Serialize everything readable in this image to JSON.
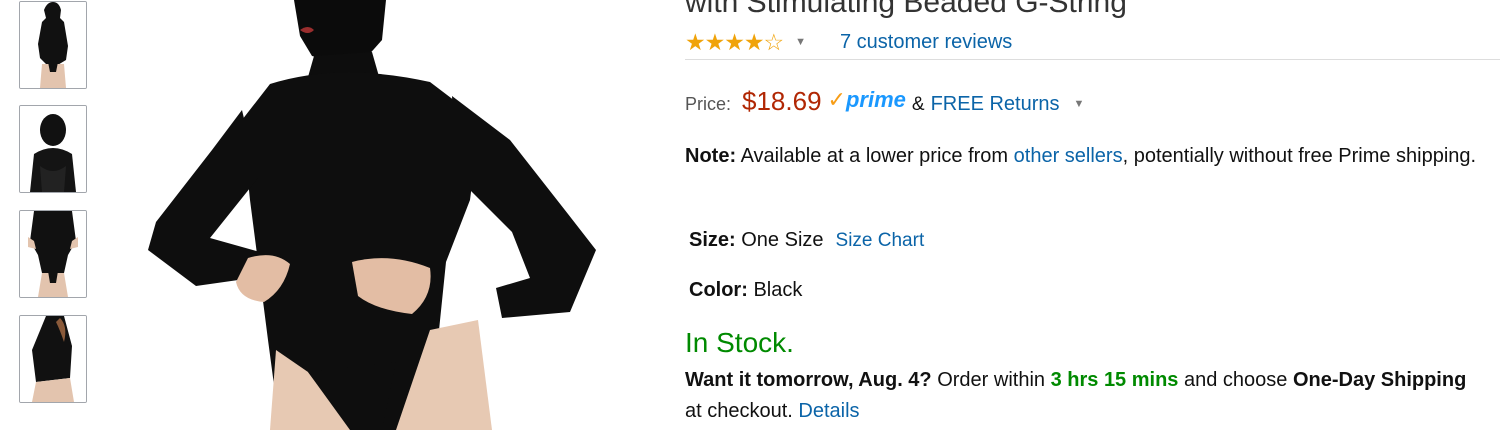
{
  "product": {
    "title": "with Stimulating Beaded G-String",
    "rating_stars": "★★★★☆",
    "reviews_link": "7 customer reviews",
    "price_label": "Price:",
    "price": "$18.69",
    "prime_check": "✓",
    "prime_label": "prime",
    "amp": "&",
    "free_returns": "FREE Returns",
    "note_label": "Note:",
    "note_text_1": " Available at a lower price from ",
    "note_link": "other sellers",
    "note_text_2": ", potentially without free Prime shipping.",
    "size_label": "Size:",
    "size_value": " One Size",
    "size_chart": "Size Chart",
    "color_label": "Color:",
    "color_value": " Black",
    "stock": "In Stock.",
    "want_label": "Want it tomorrow, Aug. 4?",
    "order_within": " Order within ",
    "time_left": "3 hrs 15 mins",
    "and_choose": " and choose ",
    "one_day": "One-Day Shipping",
    "at_checkout": " at checkout. ",
    "details": "Details"
  },
  "icons": {
    "caret": "▼"
  },
  "colors": {
    "price": "#b12704",
    "link": "#0b64a8",
    "stock": "#008a00",
    "star": "#f0a30a",
    "prime": "#1a98ff"
  }
}
